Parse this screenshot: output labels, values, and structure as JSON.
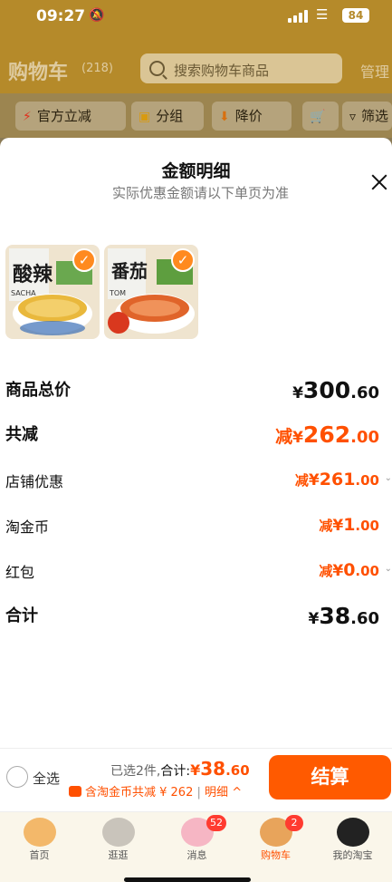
{
  "status_bar": {
    "time": "09:27",
    "battery": "84"
  },
  "cart_header": {
    "title": "购物车",
    "count": "(218)",
    "search_placeholder": "搜索购物车商品",
    "manage": "管理"
  },
  "filters": [
    {
      "label": "官方立减",
      "icon": "lightning-icon"
    },
    {
      "label": "分组",
      "icon": "folder-icon"
    },
    {
      "label": "降价",
      "icon": "arrow-down-icon"
    },
    {
      "label": "",
      "icon": "cart-icon"
    },
    {
      "label": "筛选",
      "icon": "funnel-icon"
    }
  ],
  "sheet": {
    "title": "金额明细",
    "subtitle": "实际优惠金额请以下单页为准",
    "products": [
      {
        "name": "酸辣",
        "caption": "SACHA",
        "flavor": "sour-spicy"
      },
      {
        "name": "番茄",
        "caption": "TOM",
        "flavor": "tomato"
      }
    ],
    "rows": {
      "total_price": {
        "label": "商品总价",
        "yen": "¥",
        "int": "300",
        "dec": ".60"
      },
      "total_discount": {
        "label": "共减",
        "prefix": "减",
        "yen": "¥",
        "int": "262",
        "dec": ".00"
      },
      "store_discount": {
        "label": "店铺优惠",
        "prefix": "减",
        "yen": "¥",
        "int": "261",
        "dec": ".00"
      },
      "taojinbi": {
        "label": "淘金币",
        "prefix": "减",
        "yen": "¥",
        "int": "1",
        "dec": ".00"
      },
      "red_packet": {
        "label": "红包",
        "prefix": "减",
        "yen": "¥",
        "int": "0",
        "dec": ".00"
      },
      "sum": {
        "label": "合计",
        "yen": "¥",
        "int": "38",
        "dec": ".60"
      }
    }
  },
  "bottom_bar": {
    "select_all": "全选",
    "selected_prefix": "已选2件,",
    "total_label": "合计:",
    "price_yen": "¥",
    "price_int": "38",
    "price_dec": ".60",
    "coin_text": "含淘金币共减 ¥ 262",
    "separator": "|",
    "detail": "明细",
    "detail_arrow": "^",
    "checkout": "结算"
  },
  "tabs": [
    {
      "label": "首页",
      "badge": ""
    },
    {
      "label": "逛逛",
      "badge": ""
    },
    {
      "label": "消息",
      "badge": "52"
    },
    {
      "label": "购物车",
      "badge": "2"
    },
    {
      "label": "我的淘宝",
      "badge": ""
    }
  ],
  "colors": {
    "accent": "#ff5000",
    "checkout": "#ff5a00",
    "check": "#ff8a1f"
  }
}
